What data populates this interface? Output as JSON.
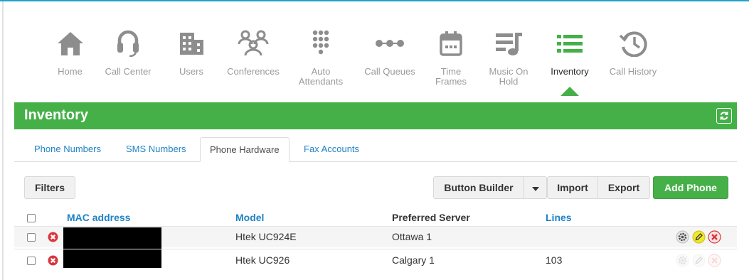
{
  "nav": {
    "items": [
      {
        "label": "Home",
        "icon": "home-icon"
      },
      {
        "label": "Call Center",
        "icon": "headset-icon"
      },
      {
        "label": "Users",
        "icon": "building-icon"
      },
      {
        "label": "Conferences",
        "icon": "people-group-icon"
      },
      {
        "label": "Auto\nAttendants",
        "icon": "keypad-icon"
      },
      {
        "label": "Call Queues",
        "icon": "queue-dots-icon"
      },
      {
        "label": "Time\nFrames",
        "icon": "calendar-icon"
      },
      {
        "label": "Music On\nHold",
        "icon": "music-note-icon"
      },
      {
        "label": "Inventory",
        "icon": "list-icon",
        "active": true
      },
      {
        "label": "Call History",
        "icon": "history-clock-icon"
      }
    ]
  },
  "page": {
    "title": "Inventory"
  },
  "tabs": [
    {
      "label": "Phone Numbers"
    },
    {
      "label": "SMS Numbers"
    },
    {
      "label": "Phone Hardware",
      "active": true
    },
    {
      "label": "Fax Accounts"
    }
  ],
  "toolbar": {
    "filters": "Filters",
    "button_builder": "Button Builder",
    "import": "Import",
    "export": "Export",
    "add_phone": "Add Phone"
  },
  "table": {
    "columns": {
      "mac": "MAC address",
      "model": "Model",
      "server": "Preferred Server",
      "lines": "Lines"
    },
    "rows": [
      {
        "mac": "",
        "model": "Htek UC924E",
        "server": "Ottawa 1",
        "lines": "",
        "mac_redacted": true
      },
      {
        "mac": "",
        "model": "Htek UC926",
        "server": "Calgary 1",
        "lines": "103",
        "mac_redacted": true
      }
    ]
  },
  "colors": {
    "brand_green": "#45b048",
    "link_blue": "#1f83c5",
    "delete_red": "#d9363e",
    "highlight_yellow": "#f0e82a"
  }
}
